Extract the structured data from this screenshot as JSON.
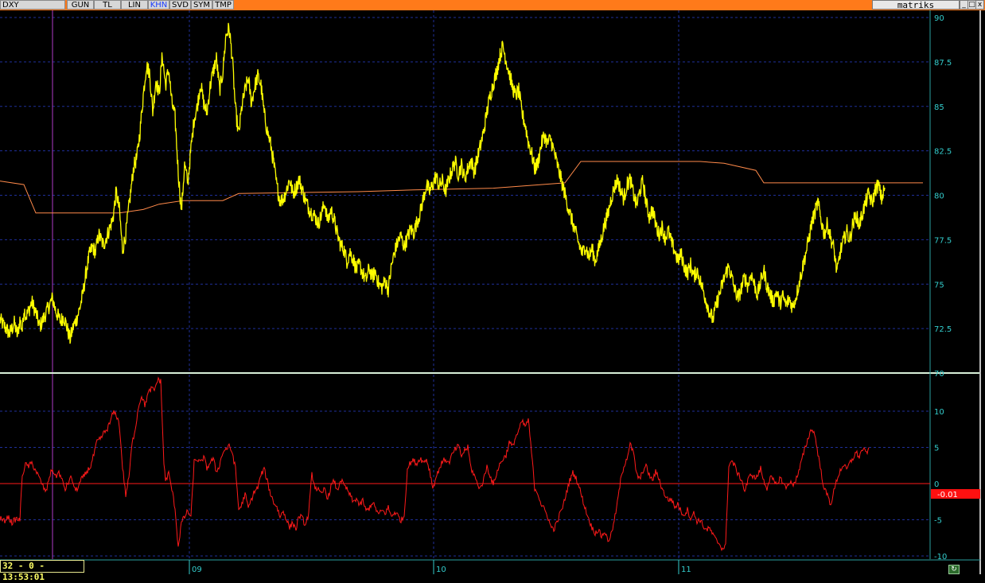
{
  "toolbar": {
    "symbol": "DXY",
    "buttons": [
      "GUN",
      "TL",
      "LIN",
      "KHN",
      "SVD",
      "SYM",
      "TMP"
    ],
    "active": "KHN",
    "brand": "matriks",
    "window_buttons": [
      "_",
      "□",
      "x"
    ]
  },
  "status": {
    "time_text": "32 - 0 - 13:53:01"
  },
  "colors": {
    "topbar": "#ff7a1a",
    "price": "#ffff00",
    "average": "#ff8a4a",
    "oscillator": "#ff1a1a",
    "grid": "#1f2f9a",
    "axis_text": "#33cccc",
    "cursor": "#b03cc8"
  },
  "chart_data": [
    {
      "type": "line",
      "y_ticks": [
        "90",
        "87.5",
        "85",
        "82.5",
        "80",
        "77.5",
        "75",
        "72.5",
        "70"
      ],
      "ylim": [
        70,
        90
      ],
      "x_labels": [
        "09",
        "10",
        "11"
      ],
      "series_note_no_legend": true,
      "price_anchors_x": [
        0,
        6,
        12,
        18,
        22,
        25,
        28,
        30,
        33,
        36,
        40,
        45,
        50,
        56,
        62,
        66,
        70,
        76,
        80,
        84,
        88,
        92,
        96,
        100,
        104,
        108,
        112,
        116,
        120,
        124,
        130,
        136,
        142,
        146,
        150,
        154,
        158,
        163,
        168,
        172,
        176,
        180,
        184,
        188,
        192,
        196,
        200,
        204,
        208,
        212,
        216,
        220,
        224,
        228,
        232,
        236,
        240,
        244,
        248,
        252,
        256,
        260,
        264,
        268,
        272,
        276,
        280,
        284,
        288,
        292,
        296,
        300,
        304,
        308,
        312,
        316,
        320,
        324,
        328,
        332,
        336,
        340,
        344,
        348,
        352,
        356,
        360,
        364,
        368,
        372,
        376,
        380,
        384,
        388,
        392,
        396,
        400,
        404,
        408,
        412,
        416,
        420,
        424,
        428,
        432,
        436,
        440,
        444,
        448,
        452,
        456,
        460,
        464,
        468,
        472,
        476,
        480,
        484,
        488,
        492,
        496,
        500,
        504,
        508,
        512,
        516,
        520,
        524,
        528,
        532,
        536,
        540,
        544,
        548,
        552,
        556,
        560,
        564,
        568,
        572,
        576,
        580,
        584,
        588,
        592,
        596,
        600,
        604,
        608,
        612,
        616,
        620,
        624,
        628,
        632,
        636,
        640,
        644,
        648,
        652,
        656,
        660,
        664,
        668,
        672,
        676,
        680,
        684,
        688,
        692,
        696,
        700,
        704,
        708,
        712,
        716,
        720,
        724,
        728,
        732,
        736,
        740,
        744,
        748,
        752,
        756,
        760,
        764,
        768,
        772,
        776,
        780,
        784,
        788,
        792,
        796,
        800,
        804,
        808,
        812,
        816,
        820,
        824,
        828,
        832,
        836,
        840,
        844,
        848,
        852,
        856,
        860,
        864,
        868,
        872,
        876,
        880,
        884,
        888,
        892,
        896,
        900,
        904,
        908,
        912,
        916,
        920,
        924,
        928,
        932,
        936,
        940,
        944,
        948,
        952,
        956,
        960,
        964,
        968,
        972,
        976,
        980,
        984,
        988,
        992,
        996,
        1000,
        1004,
        1008,
        1012,
        1016,
        1020,
        1024,
        1028,
        1032,
        1036,
        1040,
        1044,
        1048,
        1052,
        1056,
        1060,
        1064,
        1068,
        1072,
        1076,
        1080,
        1084,
        1088,
        1092,
        1096,
        1100,
        1104,
        1108,
        1112,
        1116,
        1120,
        1124,
        1128,
        1132,
        1136,
        1140,
        1144,
        1148,
        1152,
        1156,
        1160
      ],
      "price_values": [
        73.0,
        72.6,
        72.2,
        72.8,
        72.1,
        73.0,
        72.4,
        73.6,
        73.2,
        73.5,
        74.0,
        73.4,
        72.6,
        73.2,
        73.8,
        74.2,
        73.5,
        72.9,
        73.2,
        72.6,
        71.9,
        72.6,
        73.0,
        73.6,
        74.4,
        75.6,
        76.6,
        77.1,
        76.8,
        77.8,
        77.2,
        77.9,
        78.7,
        80.2,
        79.2,
        76.9,
        77.8,
        79.7,
        81.6,
        82.1,
        83.6,
        85.6,
        87.3,
        86.9,
        84.7,
        86.5,
        85.7,
        87.9,
        86.2,
        87.1,
        85.2,
        84.4,
        81.3,
        79.1,
        81.7,
        80.7,
        82.6,
        84.3,
        85.0,
        86.3,
        85.2,
        84.6,
        86.1,
        87.0,
        87.7,
        85.9,
        86.9,
        89.0,
        89.4,
        87.7,
        84.8,
        83.4,
        85.0,
        85.9,
        86.6,
        85.2,
        86.1,
        86.7,
        86.2,
        84.6,
        83.6,
        82.9,
        81.8,
        80.5,
        79.7,
        79.8,
        80.3,
        80.9,
        80.1,
        80.4,
        80.9,
        80.3,
        79.7,
        79.3,
        79.0,
        78.8,
        78.4,
        78.9,
        79.6,
        78.5,
        79.2,
        78.6,
        77.8,
        77.2,
        77.0,
        76.3,
        76.8,
        76.4,
        75.8,
        76.1,
        75.6,
        75.2,
        75.9,
        75.4,
        75.7,
        75.0,
        74.8,
        75.2,
        74.7,
        76.0,
        76.8,
        77.4,
        77.7,
        77.1,
        77.6,
        78.1,
        77.9,
        78.5,
        79.0,
        79.8,
        80.6,
        80.2,
        80.6,
        81.1,
        80.5,
        80.8,
        80.2,
        80.9,
        81.4,
        81.9,
        81.2,
        81.7,
        80.9,
        81.5,
        82.0,
        81.3,
        82.1,
        82.8,
        83.6,
        84.7,
        85.6,
        86.3,
        86.9,
        87.8,
        88.4,
        87.6,
        86.9,
        86.1,
        85.6,
        85.9,
        84.6,
        84.0,
        83.0,
        82.4,
        81.5,
        81.8,
        82.8,
        83.4,
        82.9,
        83.2,
        82.5,
        81.8,
        81.1,
        80.4,
        79.7,
        79.0,
        78.4,
        77.8,
        77.2,
        76.7,
        77.2,
        76.5,
        77.0,
        76.3,
        76.9,
        77.6,
        78.4,
        78.9,
        79.8,
        80.4,
        80.9,
        80.3,
        79.8,
        80.6,
        80.9,
        80.1,
        79.4,
        80.2,
        80.8,
        79.6,
        78.8,
        79.2,
        78.4,
        77.8,
        78.2,
        77.6,
        78.0,
        77.3,
        76.9,
        76.3,
        76.7,
        76.0,
        75.6,
        76.1,
        75.4,
        75.8,
        75.2,
        74.6,
        74.0,
        73.4,
        73.0,
        73.8,
        74.4,
        75.0,
        75.6,
        76.0,
        75.3,
        74.6,
        74.2,
        74.8,
        75.4,
        74.9,
        75.6,
        75.0,
        74.4,
        75.1,
        75.8,
        74.9,
        74.4,
        74.0,
        74.6,
        73.9,
        74.3,
        73.8,
        74.2,
        73.7,
        74.2,
        75.0,
        75.8,
        76.6,
        77.4,
        78.4,
        79.0,
        79.6,
        78.6,
        77.8,
        78.4,
        77.6,
        77.0,
        75.6,
        76.8,
        77.4,
        78.0,
        77.5,
        78.4,
        78.9,
        78.3,
        79.0,
        79.6,
        80.1,
        79.5,
        80.3,
        80.6,
        79.8,
        80.4
      ],
      "avg_anchors_x": [
        0,
        30,
        45,
        60,
        120,
        150,
        180,
        200,
        230,
        280,
        300,
        450,
        520,
        620,
        710,
        730,
        800,
        880,
        910,
        950,
        960,
        1160
      ],
      "avg_values": [
        80.8,
        80.6,
        79.0,
        79.0,
        79.0,
        79.0,
        79.2,
        79.5,
        79.7,
        79.7,
        80.1,
        80.2,
        80.3,
        80.4,
        80.7,
        81.9,
        81.9,
        81.9,
        81.8,
        81.4,
        80.7,
        80.7
      ]
    },
    {
      "type": "line",
      "y_ticks": [
        "10",
        "5",
        "0",
        "-5",
        "-10"
      ],
      "ylim": [
        -10,
        15
      ],
      "reference_value": 0,
      "last_value_label": "-0.01",
      "osc_anchors_x": [
        0,
        5,
        10,
        15,
        20,
        25,
        28,
        32,
        36,
        40,
        45,
        50,
        54,
        58,
        62,
        66,
        70,
        74,
        78,
        82,
        86,
        90,
        94,
        98,
        102,
        106,
        110,
        114,
        118,
        122,
        126,
        130,
        134,
        138,
        142,
        146,
        150,
        154,
        158,
        162,
        166,
        170,
        174,
        178,
        182,
        186,
        190,
        194,
        198,
        202,
        206,
        208,
        212,
        216,
        220,
        224,
        228,
        232,
        236,
        240,
        244,
        248,
        252,
        256,
        260,
        264,
        268,
        272,
        276,
        280,
        284,
        288,
        292,
        296,
        300,
        304,
        308,
        312,
        316,
        320,
        324,
        328,
        332,
        336,
        340,
        344,
        348,
        352,
        356,
        360,
        364,
        368,
        372,
        376,
        380,
        384,
        388,
        392,
        396,
        400,
        404,
        408,
        412,
        416,
        420,
        424,
        428,
        432,
        436,
        440,
        444,
        448,
        452,
        456,
        460,
        464,
        468,
        472,
        476,
        480,
        484,
        488,
        492,
        496,
        500,
        504,
        508,
        512,
        516,
        520,
        524,
        528,
        532,
        536,
        540,
        544,
        548,
        552,
        556,
        560,
        564,
        568,
        572,
        576,
        580,
        584,
        588,
        592,
        596,
        600,
        604,
        608,
        612,
        616,
        620,
        624,
        628,
        632,
        636,
        640,
        644,
        648,
        652,
        656,
        660,
        664,
        668,
        672,
        676,
        680,
        684,
        688,
        692,
        696,
        700,
        704,
        708,
        712,
        716,
        720,
        724,
        728,
        732,
        736,
        740,
        744,
        748,
        752,
        756,
        760,
        764,
        768,
        772,
        776,
        780,
        784,
        788,
        792,
        796,
        800,
        804,
        808,
        812,
        816,
        820,
        824,
        828,
        832,
        836,
        840,
        844,
        848,
        852,
        856,
        860,
        864,
        868,
        872,
        876,
        880,
        884,
        888,
        892,
        896,
        900,
        904,
        908,
        912,
        916,
        920,
        924,
        928,
        932,
        936,
        940,
        944,
        948,
        952,
        956,
        960,
        964,
        968,
        972,
        976,
        980,
        984,
        988,
        992,
        996,
        1000,
        1004,
        1008,
        1012,
        1016,
        1020,
        1024,
        1028,
        1032,
        1036,
        1040,
        1044,
        1048,
        1052,
        1056,
        1060,
        1064,
        1068,
        1072,
        1076,
        1080,
        1084,
        1088,
        1092,
        1096,
        1100,
        1104,
        1108,
        1112,
        1116,
        1120,
        1124,
        1128,
        1132,
        1136,
        1140,
        1144,
        1148,
        1152,
        1156,
        1160
      ],
      "osc_values": [
        -4.8,
        -5.2,
        -4.6,
        -5.4,
        -4.9,
        -5.0,
        1.2,
        2.6,
        2.4,
        2.8,
        1.8,
        0.6,
        -0.4,
        -1.2,
        1.0,
        2.0,
        0.9,
        1.6,
        0.4,
        -0.8,
        0.2,
        0.9,
        -0.9,
        -0.6,
        0.5,
        1.1,
        1.8,
        2.4,
        4.0,
        5.8,
        6.1,
        6.9,
        7.4,
        8.3,
        9.8,
        9.6,
        8.1,
        2.3,
        -1.6,
        0.8,
        5.5,
        7.6,
        10.6,
        12.2,
        10.8,
        12.4,
        13.1,
        12.9,
        14.3,
        14.2,
        2.8,
        0.4,
        1.4,
        -0.8,
        -3.4,
        -8.8,
        -5.4,
        -4.6,
        -3.8,
        -4.7,
        3.0,
        3.4,
        2.8,
        3.7,
        2.1,
        2.9,
        3.4,
        1.6,
        2.6,
        4.3,
        4.8,
        5.1,
        4.3,
        2.0,
        -3.6,
        -2.9,
        -1.4,
        -3.4,
        -2.2,
        -1.0,
        -0.6,
        1.2,
        2.0,
        0.3,
        -1.4,
        -2.6,
        -3.2,
        -4.6,
        -3.8,
        -4.9,
        -6.1,
        -5.4,
        -6.3,
        -4.4,
        -4.8,
        -5.8,
        -4.1,
        1.3,
        -0.5,
        -0.9,
        -1.6,
        -0.6,
        -2.1,
        -0.4,
        0.4,
        -1.1,
        0.6,
        -0.2,
        -0.8,
        -1.6,
        -2.6,
        -2.0,
        -3.1,
        -2.3,
        -3.8,
        -3.4,
        -2.6,
        -3.4,
        -4.3,
        -3.7,
        -4.1,
        -3.3,
        -4.6,
        -3.9,
        -4.4,
        -5.1,
        -4.5,
        2.1,
        2.9,
        3.2,
        2.7,
        3.6,
        2.9,
        3.4,
        1.8,
        -0.6,
        0.8,
        2.1,
        3.0,
        3.4,
        2.8,
        3.9,
        4.7,
        5.2,
        3.8,
        4.6,
        5.0,
        2.1,
        1.2,
        -0.1,
        -0.6,
        0.6,
        2.4,
        1.1,
        -0.2,
        1.4,
        2.6,
        3.4,
        3.9,
        5.7,
        5.1,
        6.4,
        7.3,
        8.6,
        7.9,
        8.8,
        4.4,
        -0.6,
        -1.3,
        -2.8,
        -3.6,
        -4.4,
        -5.9,
        -6.3,
        -5.4,
        -4.1,
        -3.0,
        -1.2,
        0.4,
        1.5,
        0.8,
        -0.5,
        -2.1,
        -3.6,
        -4.9,
        -6.1,
        -6.8,
        -6.4,
        -7.3,
        -6.6,
        -7.9,
        -7.1,
        -5.2,
        -2.6,
        0.4,
        2.4,
        3.6,
        5.4,
        4.3,
        1.4,
        0.5,
        1.8,
        2.4,
        1.2,
        0.4,
        1.6,
        0.8,
        -0.7,
        -1.6,
        -2.3,
        -2.1,
        -3.3,
        -2.8,
        -3.9,
        -4.3,
        -3.6,
        -4.8,
        -4.1,
        -5.2,
        -5.0,
        -5.9,
        -6.4,
        -6.2,
        -7.1,
        -7.8,
        -8.3,
        -9.0,
        -8.6,
        2.6,
        3.1,
        2.3,
        1.2,
        0.6,
        -1.1,
        0.4,
        1.4,
        0.8,
        1.0,
        2.1,
        0.3,
        -0.6,
        0.9,
        0.4,
        -0.3,
        0.8,
        0.2,
        -0.7,
        0.3,
        -0.2,
        0.5,
        1.6,
        3.4,
        4.9,
        6.4,
        7.6,
        6.8,
        4.2,
        1.6,
        -0.8,
        -1.6,
        -2.9,
        -1.1,
        0.6,
        1.8,
        2.6,
        1.9,
        2.8,
        3.5,
        4.3,
        3.7,
        4.8,
        4.3,
        4.6
      ]
    }
  ]
}
